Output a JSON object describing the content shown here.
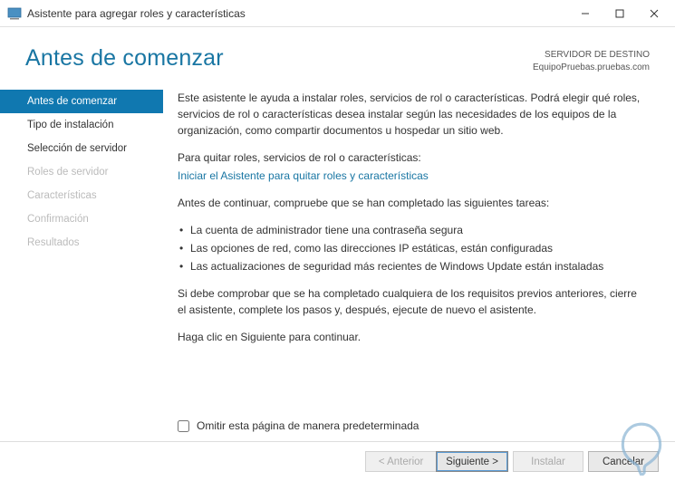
{
  "window": {
    "title": "Asistente para agregar roles y características"
  },
  "header": {
    "heading": "Antes de comenzar",
    "serverLabel": "SERVIDOR DE DESTINO",
    "serverName": "EquipoPruebas.pruebas.com"
  },
  "sidebar": {
    "steps": [
      {
        "label": "Antes de comenzar",
        "state": "active"
      },
      {
        "label": "Tipo de instalación",
        "state": "enabled"
      },
      {
        "label": "Selección de servidor",
        "state": "enabled"
      },
      {
        "label": "Roles de servidor",
        "state": "disabled"
      },
      {
        "label": "Características",
        "state": "disabled"
      },
      {
        "label": "Confirmación",
        "state": "disabled"
      },
      {
        "label": "Resultados",
        "state": "disabled"
      }
    ]
  },
  "content": {
    "intro": "Este asistente le ayuda a instalar roles, servicios de rol o características. Podrá elegir qué roles, servicios de rol o características desea instalar según las necesidades de los equipos de la organización, como compartir documentos u hospedar un sitio web.",
    "removePrompt": "Para quitar roles, servicios de rol o características:",
    "removeLink": "Iniciar el Asistente para quitar roles y características",
    "preCheck": "Antes de continuar, compruebe que se han completado las siguientes tareas:",
    "bullets": [
      "La cuenta de administrador tiene una contraseña segura",
      "Las opciones de red, como las direcciones IP estáticas, están configuradas",
      "Las actualizaciones de seguridad más recientes de Windows Update están instaladas"
    ],
    "verifyNote": "Si debe comprobar que se ha completado cualquiera de los requisitos previos anteriores, cierre el asistente, complete los pasos y, después, ejecute de nuevo el asistente.",
    "continueHint": "Haga clic en Siguiente para continuar.",
    "skip": "Omitir esta página de manera predeterminada"
  },
  "footer": {
    "previous": "< Anterior",
    "next": "Siguiente >",
    "install": "Instalar",
    "cancel": "Cancelar"
  }
}
